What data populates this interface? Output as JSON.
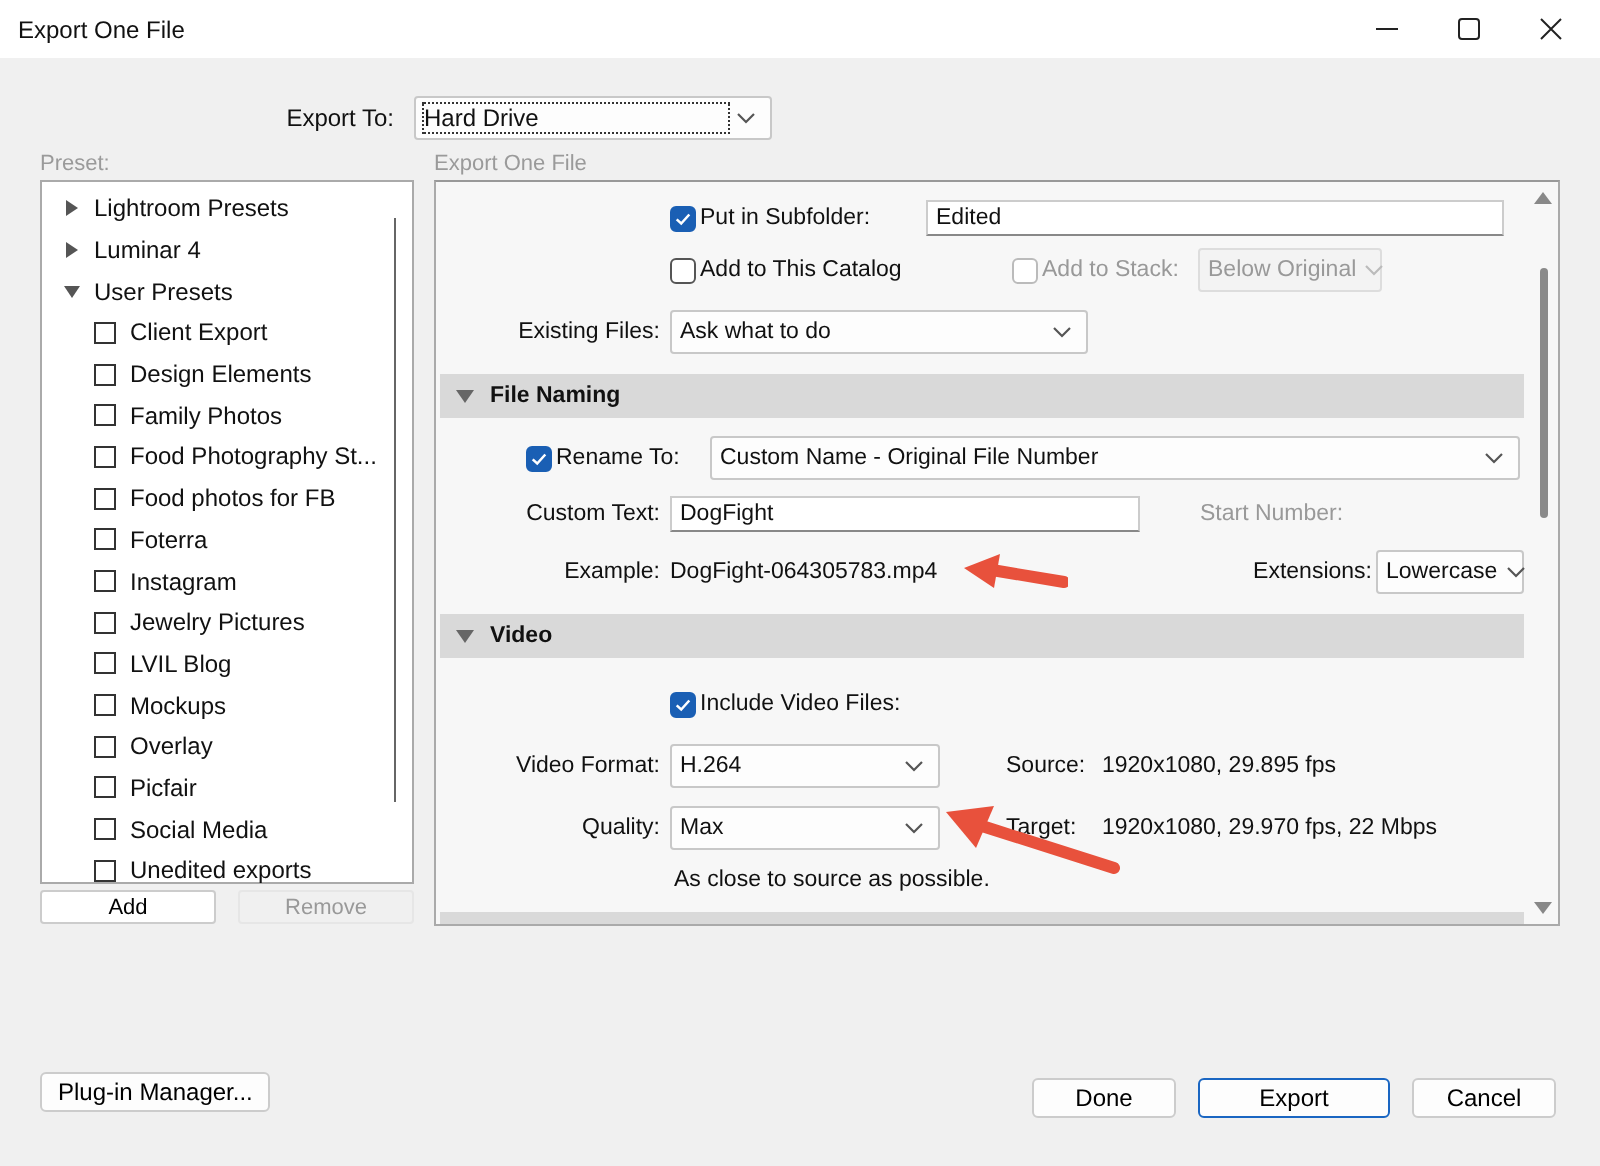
{
  "window": {
    "title": "Export One File"
  },
  "export_to": {
    "label": "Export To:",
    "value": "Hard Drive"
  },
  "preset": {
    "label": "Preset:",
    "tree": [
      {
        "label": "Lightroom Presets",
        "expanded": false
      },
      {
        "label": "Luminar 4",
        "expanded": false
      },
      {
        "label": "User Presets",
        "expanded": true,
        "children": [
          {
            "label": "Client Export",
            "checked": false
          },
          {
            "label": "Design Elements",
            "checked": false
          },
          {
            "label": "Family Photos",
            "checked": false
          },
          {
            "label": "Food Photography St...",
            "checked": false
          },
          {
            "label": "Food photos for FB",
            "checked": false
          },
          {
            "label": "Foterra",
            "checked": false
          },
          {
            "label": "Instagram",
            "checked": false
          },
          {
            "label": "Jewelry Pictures",
            "checked": false
          },
          {
            "label": "LVIL Blog",
            "checked": false
          },
          {
            "label": "Mockups",
            "checked": false
          },
          {
            "label": "Overlay",
            "checked": false
          },
          {
            "label": "Picfair",
            "checked": false
          },
          {
            "label": "Social Media",
            "checked": false
          },
          {
            "label": "Unedited exports",
            "checked": false
          }
        ]
      }
    ],
    "buttons": [
      {
        "label": "Add",
        "disabled": false
      },
      {
        "label": "Remove",
        "disabled": true
      }
    ]
  },
  "panel": {
    "title": "Export One File",
    "subfolder": {
      "label": "Put in Subfolder:",
      "checked": true,
      "value": "Edited"
    },
    "catalog": {
      "label": "Add to This Catalog",
      "checked": false
    },
    "stack": {
      "label": "Add to Stack:",
      "checked": false,
      "disabled": true,
      "value": "Below Original"
    },
    "existing_files": {
      "label": "Existing Files:",
      "value": "Ask what to do"
    },
    "file_naming": {
      "title": "File Naming",
      "expanded": true,
      "rename": {
        "label": "Rename To:",
        "checked": true,
        "value": "Custom Name - Original File Number"
      },
      "custom_text": {
        "label": "Custom Text:",
        "value": "DogFight"
      },
      "start_number": {
        "label": "Start Number:",
        "disabled": true
      },
      "example": {
        "label": "Example:",
        "value": "DogFight-064305783.mp4"
      },
      "extensions": {
        "label": "Extensions:",
        "value": "Lowercase"
      }
    },
    "video": {
      "title": "Video",
      "expanded": true,
      "include": {
        "label": "Include Video Files:",
        "checked": true
      },
      "format": {
        "label": "Video Format:",
        "value": "H.264"
      },
      "source": {
        "label": "Source:",
        "value": "1920x1080, 29.895 fps"
      },
      "quality": {
        "label": "Quality:",
        "value": "Max"
      },
      "target": {
        "label": "Target:",
        "value": "1920x1080, 29.970 fps, 22 Mbps"
      },
      "hint": "As close to source as possible."
    }
  },
  "footer": {
    "plugin_manager": "Plug-in Manager...",
    "buttons": [
      {
        "label": "Done",
        "selected": false
      },
      {
        "label": "Export",
        "selected": true
      },
      {
        "label": "Cancel",
        "selected": false
      }
    ]
  }
}
